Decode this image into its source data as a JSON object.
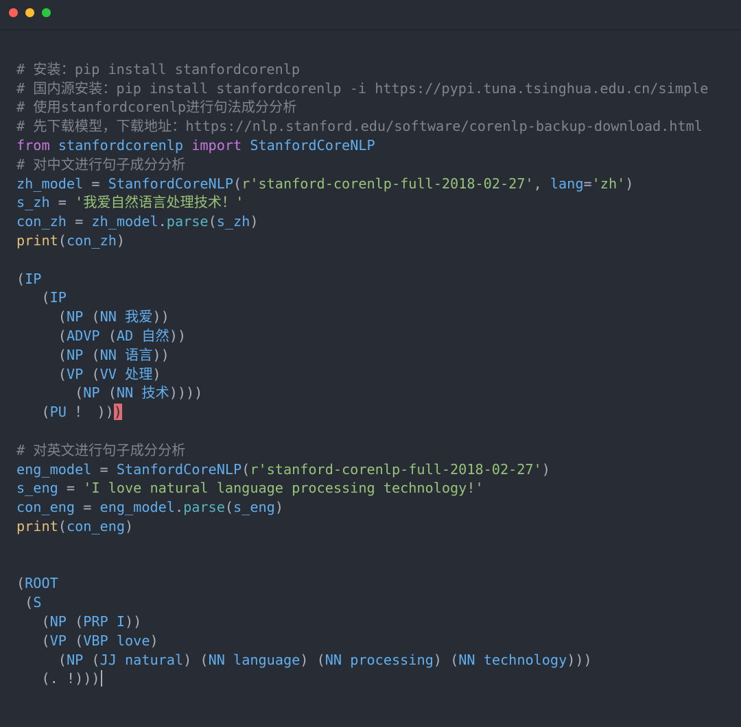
{
  "window": {
    "controls": [
      "close",
      "minimize",
      "maximize"
    ]
  },
  "code": {
    "c1": "# 安装：pip install stanfordcorenlp",
    "c2": "# 国内源安装：pip install stanfordcorenlp -i https://pypi.tuna.tsinghua.edu.cn/simple",
    "c3": "# 使用stanfordcorenlp进行句法成分分析",
    "c4": "# 先下载模型，下载地址：https://nlp.stanford.edu/software/corenlp-backup-download.html",
    "from_kw": "from",
    "module": "stanfordcorenlp",
    "import_kw": "import",
    "class_name": "StanfordCoreNLP",
    "c5": "# 对中文进行句子成分分析",
    "zh_model_var": "zh_model",
    "zh_model_path": "r'stanford-corenlp-full-2018-02-27'",
    "lang_kw": "lang",
    "lang_val": "'zh'",
    "s_zh_var": "s_zh",
    "s_zh_val": "'我爱自然语言处理技术！'",
    "con_zh_var": "con_zh",
    "parse_fn": "parse",
    "print_fn": "print",
    "zh_tree": {
      "IP": "IP",
      "NP": "NP",
      "NN": "NN",
      "ADVP": "ADVP",
      "AD": "AD",
      "VP": "VP",
      "VV": "VV",
      "PU": "PU",
      "w1": "我爱",
      "w2": "自然",
      "w3": "语言",
      "w4": "处理",
      "w5": "技术",
      "w6": "！"
    },
    "c6": "# 对英文进行句子成分分析",
    "eng_model_var": "eng_model",
    "eng_model_path": "r'stanford-corenlp-full-2018-02-27'",
    "s_eng_var": "s_eng",
    "s_eng_val": "'I love natural language processing technology!'",
    "con_eng_var": "con_eng",
    "en_tree": {
      "ROOT": "ROOT",
      "S": "S",
      "NP": "NP",
      "PRP": "PRP",
      "VP": "VP",
      "VBP": "VBP",
      "JJ": "JJ",
      "NN": "NN",
      "w1": "I",
      "w2": "love",
      "w3": "natural",
      "w4": "language",
      "w5": "processing",
      "w6": "technology",
      "dot": ".",
      "bang": "!"
    }
  }
}
